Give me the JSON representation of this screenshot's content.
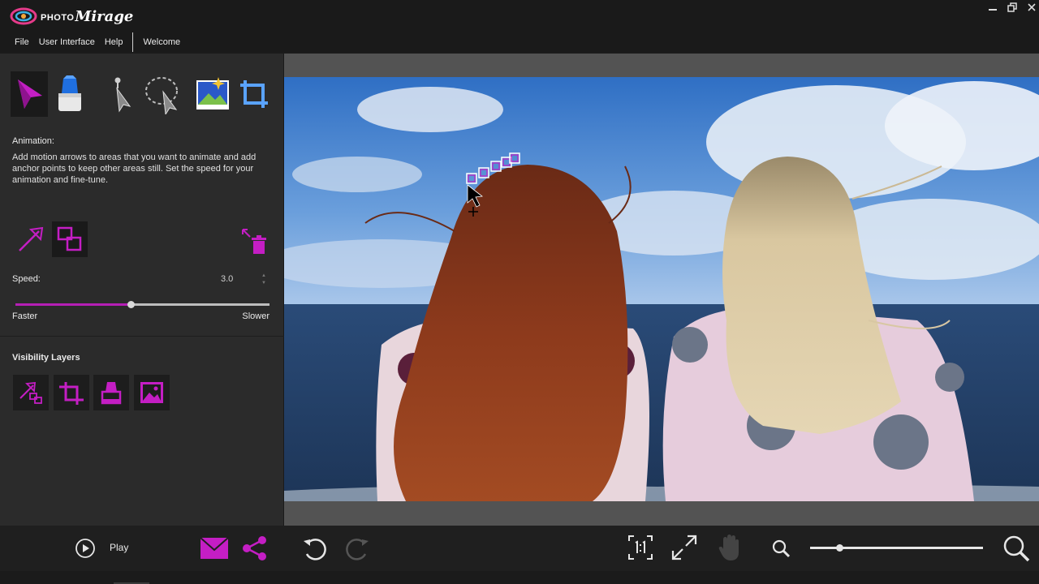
{
  "app": {
    "logo_small": "PHOTO",
    "logo_big": "Mirage",
    "window_controls": [
      "minimize-icon",
      "restore-icon",
      "close-icon"
    ]
  },
  "menu": {
    "items": [
      "File",
      "User Interface",
      "Help"
    ],
    "tab": "Welcome"
  },
  "tools": [
    {
      "name": "animation-tool",
      "icon": "animation-arrow-icon",
      "active": true
    },
    {
      "name": "eraser-tool",
      "icon": "eraser-icon",
      "active": false
    },
    {
      "name": "select-tool",
      "icon": "pointer-select-icon",
      "active": false
    },
    {
      "name": "lasso-tool",
      "icon": "lasso-select-icon",
      "active": false
    },
    {
      "name": "image-tool",
      "icon": "image-icon",
      "active": false
    },
    {
      "name": "crop-tool",
      "icon": "crop-icon",
      "active": false
    }
  ],
  "panel": {
    "title": "Animation:",
    "description": "Add motion arrows to areas that you want to animate and add anchor points to keep other areas still. Set the speed for your animation and fine-tune.",
    "speed_label": "Speed:",
    "speed_value": "3.0",
    "speed_slider_fraction": 0.455,
    "slider_min_label": "Faster",
    "slider_max_label": "Slower",
    "visibility_title": "Visibility Layers"
  },
  "bottom": {
    "play_label": "Play",
    "zoom_fraction": 0.17
  },
  "colors": {
    "accent": "#b51fb5",
    "panel_bg": "#2b2b2b",
    "app_bg": "#1b1b1b",
    "canvas_bg": "#535353"
  }
}
